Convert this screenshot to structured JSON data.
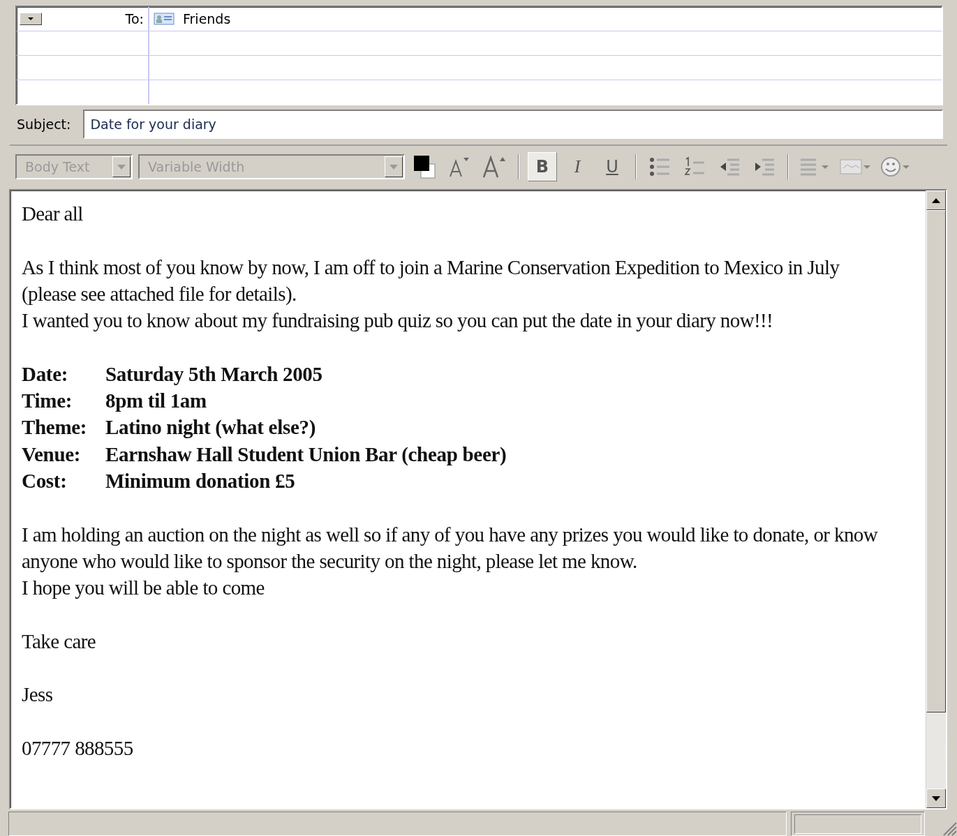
{
  "recipients": [
    {
      "type": "To:",
      "address": "Friends"
    }
  ],
  "subject": {
    "label": "Subject:",
    "value": "Date for your diary"
  },
  "toolbar": {
    "paragraph_style": {
      "value": "Body Text",
      "disabled": true
    },
    "font": {
      "value": "Variable Width",
      "disabled": true
    },
    "styles": [
      {
        "kind": "bold",
        "label": "B",
        "selected": true
      },
      {
        "kind": "italic",
        "label": "I",
        "selected": false
      },
      {
        "kind": "underline",
        "label": "U",
        "selected": false
      }
    ]
  },
  "body": [
    {
      "kind": "text",
      "text": "Dear all"
    },
    {
      "kind": "blank"
    },
    {
      "kind": "text",
      "text": "As I think most of you know by now, I am off to join a Marine Conservation Expedition to Mexico in July"
    },
    {
      "kind": "text",
      "text": "(please see attached file for details)."
    },
    {
      "kind": "text",
      "text": "I wanted you to know about my fundraising pub quiz so you can put the date in your diary now!!!"
    },
    {
      "kind": "blank"
    },
    {
      "kind": "detail",
      "label": "Date:",
      "value": "Saturday 5th March 2005"
    },
    {
      "kind": "detail",
      "label": "Time:",
      "value": "8pm til 1am"
    },
    {
      "kind": "detail",
      "label": "Theme:",
      "value": "Latino night (what else?)"
    },
    {
      "kind": "detail",
      "label": "Venue:",
      "value": "Earnshaw Hall Student Union Bar (cheap beer)"
    },
    {
      "kind": "detail",
      "label": "Cost:",
      "value": "Minimum donation £5"
    },
    {
      "kind": "blank"
    },
    {
      "kind": "text",
      "text": "I am holding an auction on the night as well so if any of you have any prizes you would like to donate, or know"
    },
    {
      "kind": "text",
      "text": "anyone who would like to sponsor the security on the night, please let me know."
    },
    {
      "kind": "text",
      "text": "I hope you will be able to come"
    },
    {
      "kind": "blank"
    },
    {
      "kind": "text",
      "text": "Take care"
    },
    {
      "kind": "blank"
    },
    {
      "kind": "text",
      "text": "Jess"
    },
    {
      "kind": "blank"
    },
    {
      "kind": "text",
      "text": "07777 888555"
    }
  ]
}
